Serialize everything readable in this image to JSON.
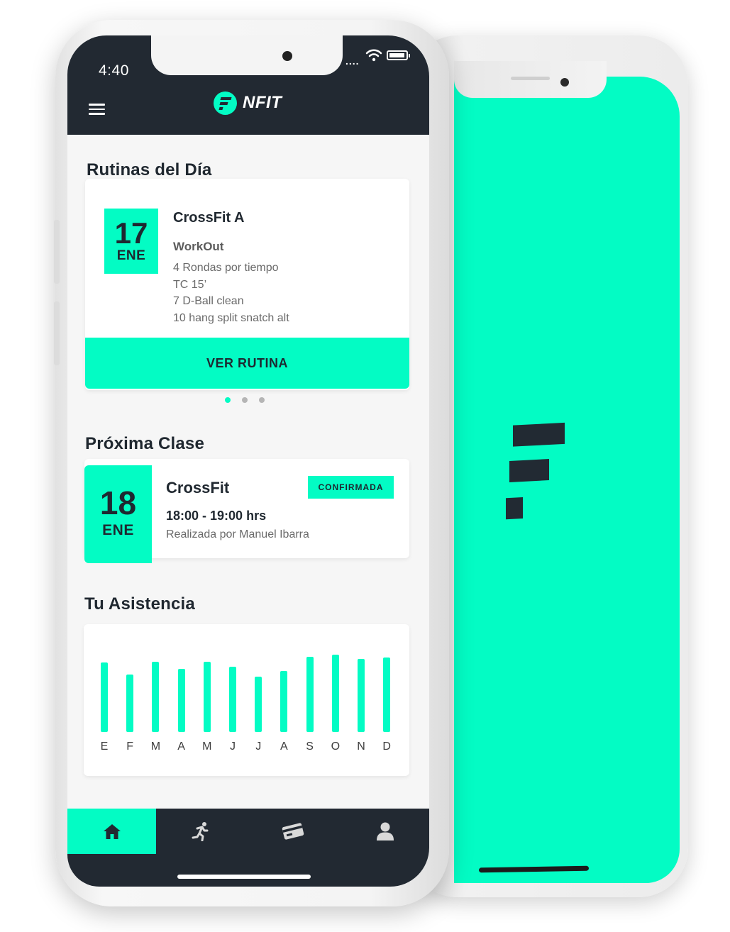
{
  "status_bar": {
    "time": "4:40",
    "signal": "....",
    "wifi_icon": "wifi-icon",
    "battery_icon": "battery-icon"
  },
  "header": {
    "menu_icon": "hamburger-menu-icon",
    "brand_name": "NFIT"
  },
  "routines": {
    "title": "Rutinas del Día",
    "day": "17",
    "month": "ENE",
    "name": "CrossFit A",
    "subtitle": "WorkOut",
    "lines": [
      "4 Rondas por tiempo",
      "TC 15’",
      "7 D-Ball clean",
      "10 hang split snatch alt"
    ],
    "button_label": "VER RUTINA",
    "pager_count": 3,
    "pager_active": 0
  },
  "next_class": {
    "title": "Próxima Clase",
    "day": "18",
    "month": "ENE",
    "name": "CrossFit",
    "status": "CONFIRMADA",
    "time": "18:00 - 19:00 hrs",
    "instructor": "Realizada por Manuel Ibarra"
  },
  "attendance": {
    "title": "Tu Asistencia",
    "chart_data": {
      "type": "bar",
      "categories": [
        "E",
        "F",
        "M",
        "A",
        "M",
        "J",
        "J",
        "A",
        "S",
        "O",
        "N",
        "D"
      ],
      "values": [
        96,
        80,
        97,
        87,
        97,
        90,
        77,
        84,
        104,
        107,
        101,
        103
      ],
      "ylim": [
        0,
        110
      ]
    }
  },
  "bottom_nav": [
    {
      "icon": "home-icon",
      "active": true
    },
    {
      "icon": "running-icon",
      "active": false
    },
    {
      "icon": "card-icon",
      "active": false
    },
    {
      "icon": "user-icon",
      "active": false
    }
  ],
  "colors": {
    "accent": "#03fcc4",
    "dark": "#222932",
    "background": "#f6f6f6"
  }
}
